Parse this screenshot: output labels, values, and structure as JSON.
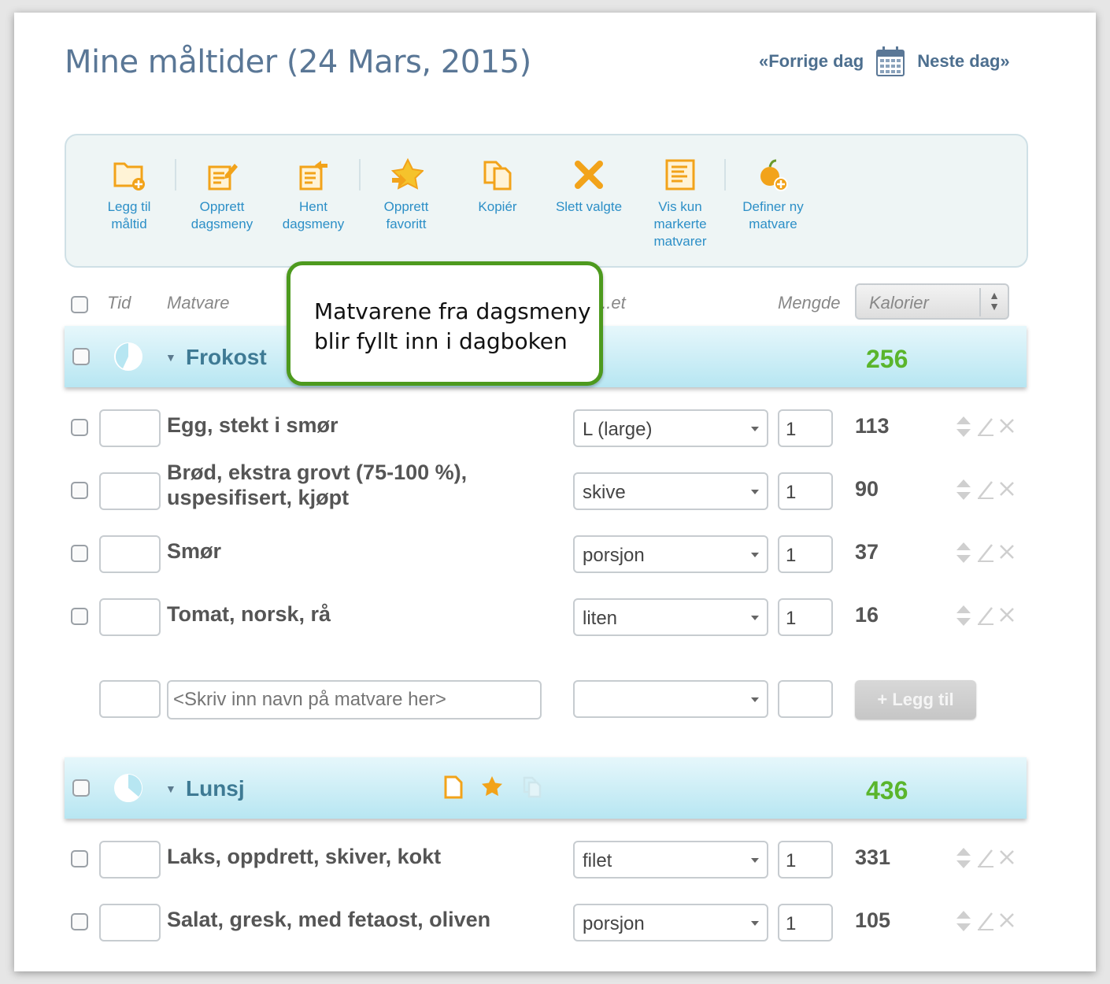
{
  "title": "Mine måltider (24 Mars, 2015)",
  "nav": {
    "prev": "«Forrige dag",
    "next": "Neste dag»"
  },
  "toolbar": [
    {
      "icon": "add-folder-icon",
      "label": "Legg til\nmåltid"
    },
    {
      "icon": "create-menu-icon",
      "label": "Opprett\ndagsmeny"
    },
    {
      "icon": "fetch-menu-icon",
      "label": "Hent\ndagsmeny"
    },
    {
      "icon": "favorite-star-icon",
      "label": "Opprett\nfavoritt"
    },
    {
      "icon": "copy-icon",
      "label": "Kopiér"
    },
    {
      "icon": "delete-x-icon",
      "label": "Slett valgte"
    },
    {
      "icon": "list-icon",
      "label": "Vis kun\nmarkerte\nmatvarer"
    },
    {
      "icon": "new-food-icon",
      "label": "Definer ny\nmatvare"
    }
  ],
  "headers": {
    "time": "Tid",
    "food": "Matvare",
    "unit": "...et",
    "amount": "Mengde",
    "nutrient_select": "Kalorier"
  },
  "callout": "Matvarene fra dagsmeny\nblir fyllt inn i dagboken",
  "meals": [
    {
      "name": "Frokost",
      "kcal": "256",
      "items": [
        {
          "name": "Egg, stekt i smør",
          "unit": "L (large)",
          "qty": "1",
          "kcal": "113"
        },
        {
          "name": "Brød, ekstra grovt (75-100 %),\nuspesifisert, kjøpt",
          "unit": "skive",
          "qty": "1",
          "kcal": "90"
        },
        {
          "name": "Smør",
          "unit": "porsjon",
          "qty": "1",
          "kcal": "37"
        },
        {
          "name": "Tomat, norsk, rå",
          "unit": "liten",
          "qty": "1",
          "kcal": "16"
        }
      ],
      "add_row": {
        "placeholder": "<Skriv inn navn på matvare her>",
        "button": "+ Legg til"
      }
    },
    {
      "name": "Lunsj",
      "kcal": "436",
      "items": [
        {
          "name": "Laks, oppdrett, skiver, kokt",
          "unit": "filet",
          "qty": "1",
          "kcal": "331"
        },
        {
          "name": "Salat, gresk, med fetaost, oliven",
          "unit": "porsjon",
          "qty": "1",
          "kcal": "105"
        }
      ]
    }
  ],
  "colors": {
    "title": "#5a7796",
    "link": "#2c8fc7",
    "kcal_total": "#5ab52c",
    "callout_border": "#4d9a1e",
    "icon_orange": "#f2a31a"
  }
}
